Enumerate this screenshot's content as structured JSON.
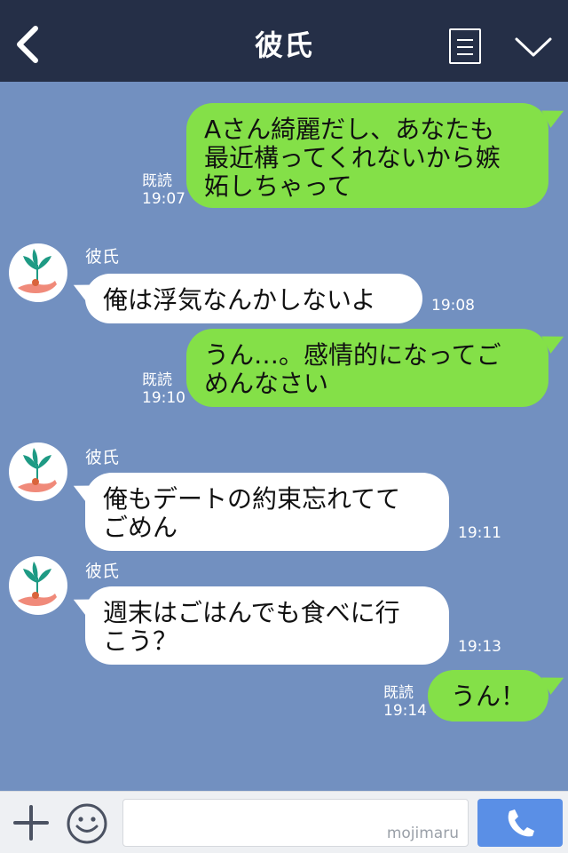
{
  "header": {
    "title": "彼氏"
  },
  "icons": {
    "back": "chevron-left-icon",
    "menu": "list-icon",
    "collapse": "chevron-down-icon",
    "add": "plus-icon",
    "emoji": "smiley-icon",
    "call": "phone-icon"
  },
  "colors": {
    "header_bg": "#252f47",
    "chat_bg": "#7290c0",
    "my_bubble": "#84e048",
    "their_bubble": "#ffffff",
    "call_button": "#5a8fe6"
  },
  "messages": [
    {
      "from": "me",
      "lines": [
        "Aさん綺麗だし、あなたも",
        "最近構ってくれないから嫉",
        "妬しちゃって"
      ],
      "read": "既読",
      "time": "19:07"
    },
    {
      "from": "them",
      "sender": "彼氏",
      "lines": [
        "俺は浮気なんかしないよ"
      ],
      "time": "19:08"
    },
    {
      "from": "me",
      "lines": [
        "うん…。感情的になってご",
        "めんなさい"
      ],
      "read": "既読",
      "time": "19:10"
    },
    {
      "from": "them",
      "sender": "彼氏",
      "lines": [
        "俺もデートの約束忘れてて",
        "ごめん"
      ],
      "time": "19:11"
    },
    {
      "from": "them",
      "sender": "彼氏",
      "lines": [
        "週末はごはんでも食べに行",
        "こう？"
      ],
      "time": "19:13"
    },
    {
      "from": "me",
      "lines": [
        "うん！"
      ],
      "read": "既読",
      "time": "19:14"
    }
  ],
  "footer": {
    "input_value": "",
    "watermark": "mojimaru"
  }
}
